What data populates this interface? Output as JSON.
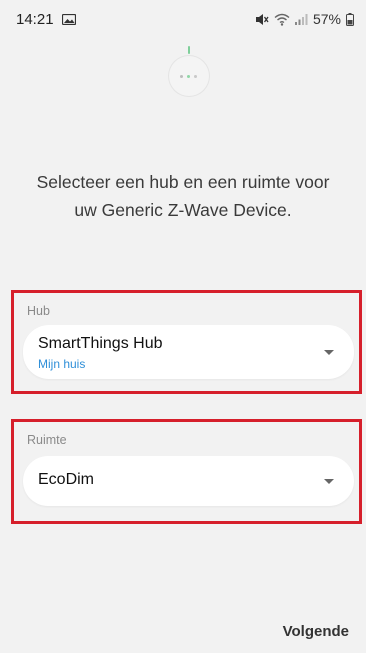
{
  "status_bar": {
    "time": "14:21",
    "battery": "57%",
    "icons": [
      "image-icon",
      "mute-icon",
      "wifi-icon",
      "signal-icon",
      "battery-icon"
    ]
  },
  "loader": {
    "icon": "loading-dots-icon",
    "colors": [
      "#bdbdbd",
      "#8fd6a6",
      "#c9c9c9"
    ]
  },
  "prompt": {
    "text": "Selecteer een hub en een ruimte voor uw Generic Z-Wave Device."
  },
  "hub": {
    "label": "Hub",
    "selected": "SmartThings Hub",
    "subtext": "Mijn huis",
    "icon": "chevron-down-icon"
  },
  "room": {
    "label": "Ruimte",
    "selected": "EcoDim",
    "icon": "chevron-down-icon"
  },
  "footer": {
    "next_label": "Volgende"
  },
  "colors": {
    "highlight": "#d61f2b",
    "link": "#2f8fd8",
    "background": "#f2f2f2"
  }
}
